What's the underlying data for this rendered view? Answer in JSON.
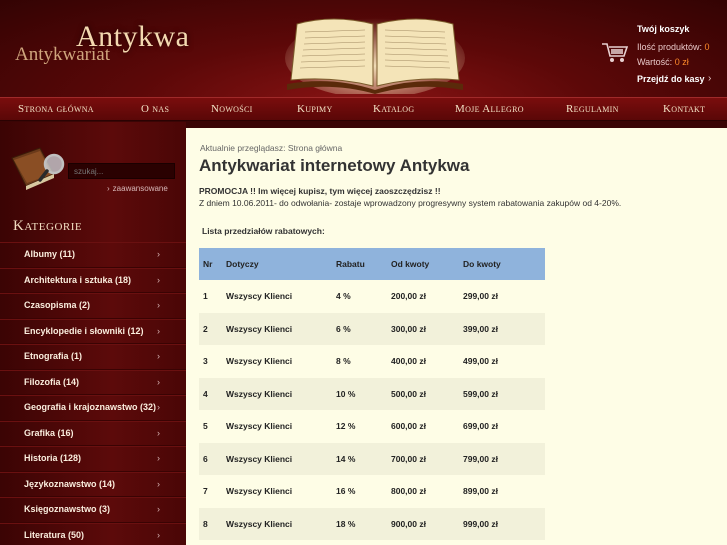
{
  "header": {
    "logo_main": "Antykwa",
    "logo_sub": "Antykwariat",
    "cart": {
      "title": "Twój koszyk",
      "products_label": "Ilość produktów:",
      "products_value": "0",
      "value_label": "Wartość:",
      "value_value": "0 zł",
      "checkout_label": "Przejdź do kasy",
      "checkout_arrow": "›"
    }
  },
  "nav": {
    "items": [
      "Strona główna",
      "O nas",
      "Nowości",
      "Kupimy",
      "Katalog",
      "Moje Allegro",
      "Regulamin",
      "Kontakt"
    ]
  },
  "sidebar": {
    "search_placeholder": "szukaj...",
    "advanced_label": "zaawansowane",
    "advanced_arrow": "›",
    "categories_title": "Kategorie",
    "category_arrow": "›",
    "categories": [
      "Albumy (11)",
      "Architektura i sztuka (18)",
      "Czasopisma (2)",
      "Encyklopedie i słowniki (12)",
      "Etnografia (1)",
      "Filozofia (14)",
      "Geografia i krajoznawstwo (32)",
      "Grafika (16)",
      "Historia (128)",
      "Językoznawstwo (14)",
      "Księgoznawstwo (3)",
      "Literatura (50)"
    ]
  },
  "main": {
    "breadcrumb": "Aktualnie przeglądasz:  Strona główna",
    "title": "Antykwariat internetowy Antykwa",
    "promo_head": "PROMOCJA !! Im więcej kupisz, tym więcej zaoszczędzisz !!",
    "promo_text": "Z dniem 10.06.2011- do odwołania- zostaje wprowadzony progresywny system rabatowania zakupów od 4-20%.",
    "list_title": "Lista przedziałów rabatowych:",
    "table": {
      "headers": [
        "Nr",
        "Dotyczy",
        "Rabatu",
        "Od kwoty",
        "Do kwoty"
      ],
      "rows": [
        [
          "1",
          "Wszyscy Klienci",
          "4 %",
          "200,00 zł",
          "299,00 zł"
        ],
        [
          "2",
          "Wszyscy Klienci",
          "6 %",
          "300,00 zł",
          "399,00 zł"
        ],
        [
          "3",
          "Wszyscy Klienci",
          "8 %",
          "400,00 zł",
          "499,00 zł"
        ],
        [
          "4",
          "Wszyscy Klienci",
          "10 %",
          "500,00 zł",
          "599,00 zł"
        ],
        [
          "5",
          "Wszyscy Klienci",
          "12 %",
          "600,00 zł",
          "699,00 zł"
        ],
        [
          "6",
          "Wszyscy Klienci",
          "14 %",
          "700,00 zł",
          "799,00 zł"
        ],
        [
          "7",
          "Wszyscy Klienci",
          "16 %",
          "800,00 zł",
          "899,00 zł"
        ],
        [
          "8",
          "Wszyscy Klienci",
          "18 %",
          "900,00 zł",
          "999,00 zł"
        ]
      ]
    }
  },
  "colors": {
    "header_red": "#5c0808",
    "nav_red": "#7a0d0d",
    "content_bg": "#fefde6",
    "table_header": "#8fb3dc",
    "accent_orange": "#ff8a2a"
  }
}
